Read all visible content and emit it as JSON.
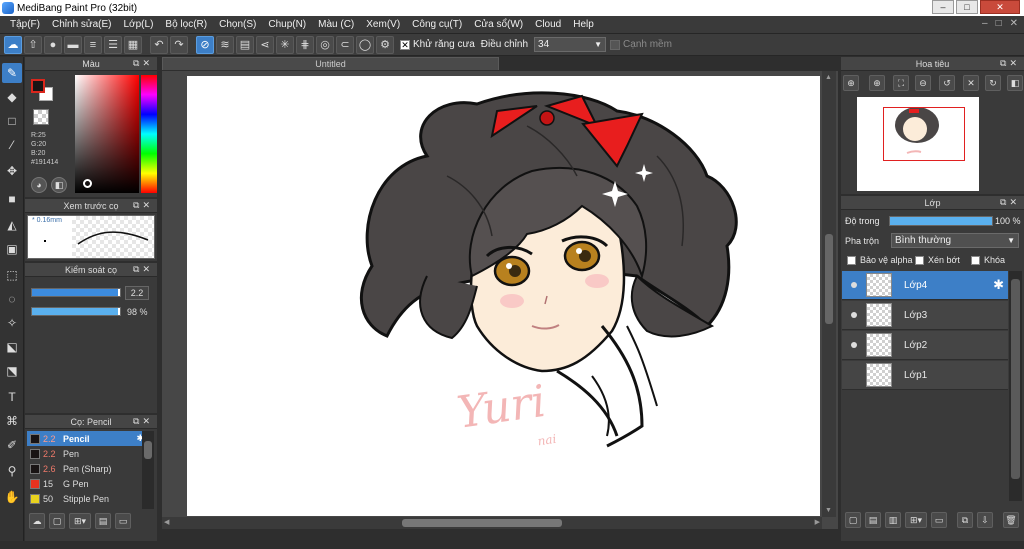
{
  "window": {
    "title": "MediBang Paint Pro (32bit)",
    "buttons": [
      "–",
      "□",
      "✕"
    ]
  },
  "menubar": {
    "items": [
      "Tập(F)",
      "Chỉnh sửa(E)",
      "Lớp(L)",
      "Bộ lọc(R)",
      "Chọn(S)",
      "Chup(N)",
      "Màu (C)",
      "Xem(V)",
      "Công cụ(T)",
      "Cửa sổ(W)",
      "Cloud",
      "Help"
    ],
    "right": [
      "–",
      "□",
      "✕"
    ]
  },
  "toolbar": {
    "antialias_label": "Khử răng cưa",
    "antialias_checked": "✕",
    "correction_label": "Điều chỉnh",
    "correction_value": "34",
    "edge_label": "Cạnh mềm"
  },
  "color_panel": {
    "title": "Màu",
    "r": "R:25",
    "g": "G:20",
    "b": "B:20",
    "hex": "#191414",
    "foreground": "#191414"
  },
  "brush_preview": {
    "title": "Xem trước cọ",
    "size": "* 0.16mm"
  },
  "brush_control": {
    "title": "Kiểm soát cọ",
    "size_value": "2.2",
    "opacity_value": "98 %",
    "size_fraction": 0.98,
    "opacity_fraction": 0.98
  },
  "brush_list": {
    "title": "Cọ: Pencil",
    "items": [
      {
        "size": "2.2",
        "name": "Pencil",
        "color": "#191414"
      },
      {
        "size": "2.2",
        "name": "Pen",
        "color": "#191414"
      },
      {
        "size": "2.6",
        "name": "Pen (Sharp)",
        "color": "#191414"
      },
      {
        "size": "15",
        "name": "G Pen",
        "color": "#e8321f"
      },
      {
        "size": "50",
        "name": "Stipple Pen",
        "color": "#e8d21f"
      }
    ]
  },
  "document": {
    "tab_title": "Untitled",
    "signature_text": "Yuri",
    "signature_small": "nai"
  },
  "navigator": {
    "title": "Hoa tiêu"
  },
  "layer_panel": {
    "title": "Lớp",
    "opacity_label": "Độ trong",
    "opacity_value": "100 %",
    "opacity_fraction": 1.0,
    "blend_label": "Pha trộn",
    "blend_value": "Bình thường",
    "protect_alpha": "Bảo vệ alpha",
    "clipping": "Xén bớt",
    "lock": "Khóa",
    "layers": [
      {
        "name": "Lớp4",
        "visible": true,
        "selected": true
      },
      {
        "name": "Lớp3",
        "visible": true,
        "selected": false
      },
      {
        "name": "Lớp2",
        "visible": true,
        "selected": false
      },
      {
        "name": "Lớp1",
        "visible": false,
        "selected": false
      }
    ]
  }
}
